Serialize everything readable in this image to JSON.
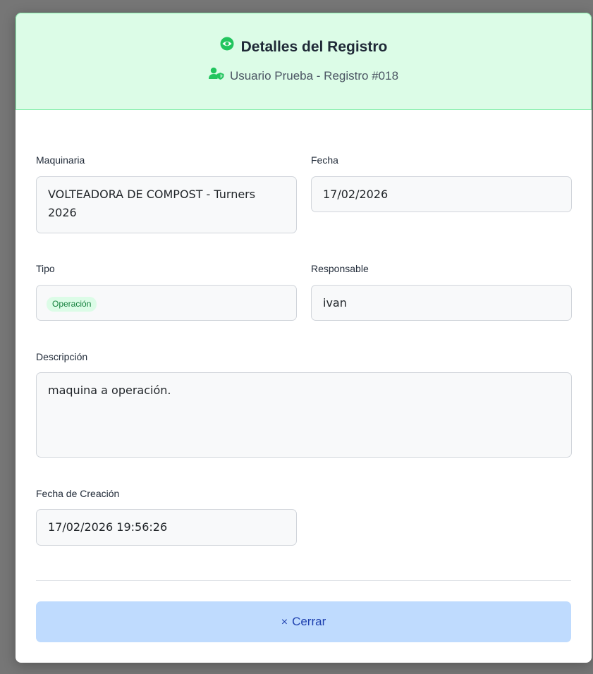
{
  "modal": {
    "title": "Detalles del Registro",
    "subtitle": "Usuario Prueba - Registro #018",
    "accent_color": "#22c55e",
    "header_bg": "#dcfce7"
  },
  "fields": {
    "maquinaria": {
      "label": "Maquinaria",
      "value": "VOLTEADORA DE COMPOST - Turners 2026"
    },
    "fecha": {
      "label": "Fecha",
      "value": "17/02/2026"
    },
    "tipo": {
      "label": "Tipo",
      "value": "Operación"
    },
    "responsable": {
      "label": "Responsable",
      "value": "ivan"
    },
    "descripcion": {
      "label": "Descripción",
      "value": "maquina a operación."
    },
    "fecha_creacion": {
      "label": "Fecha de Creación",
      "value": "17/02/2026 19:56:26"
    }
  },
  "footer": {
    "close_icon": "×",
    "close_label": "Cerrar"
  },
  "icons": {
    "title_icon": "eye-icon",
    "subtitle_icon": "user-shield-icon"
  }
}
